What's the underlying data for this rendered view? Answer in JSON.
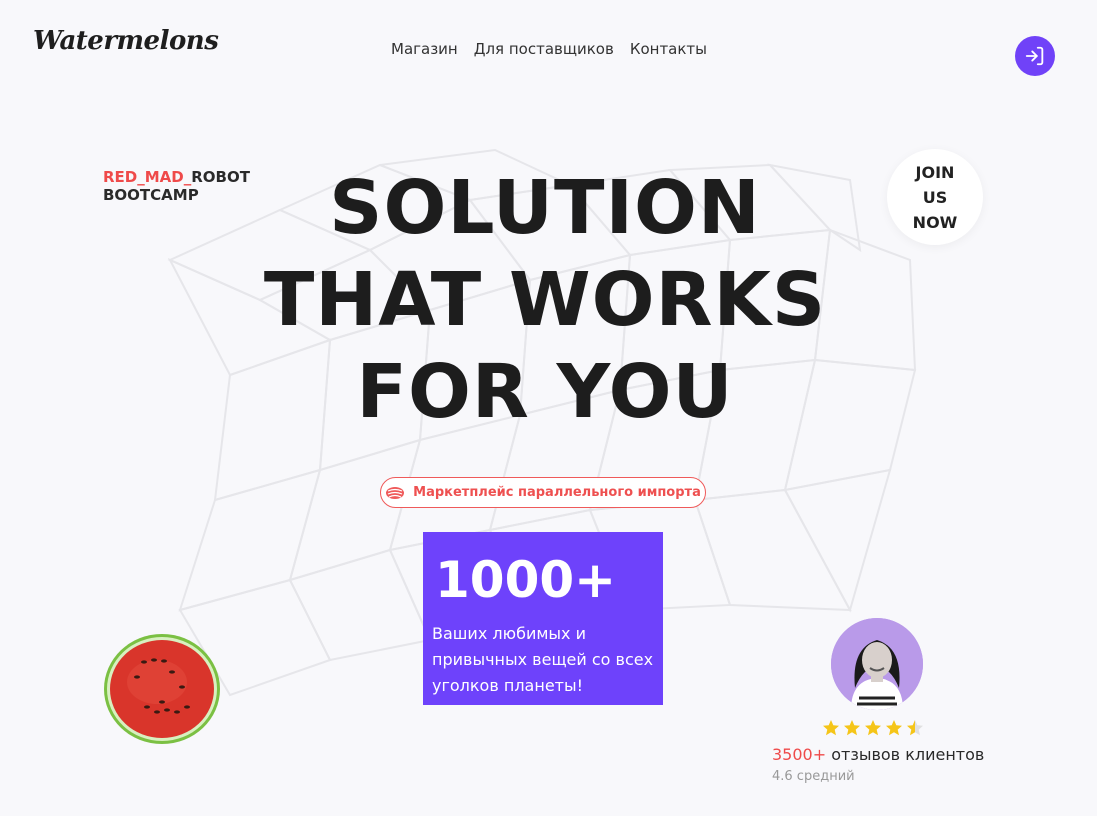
{
  "logo": {
    "text": "Watermelons"
  },
  "nav": {
    "items": [
      {
        "label": "Магазин"
      },
      {
        "label": "Для поставщиков"
      },
      {
        "label": "Контакты"
      }
    ]
  },
  "login": {
    "icon": "login-icon"
  },
  "brand_tag": {
    "red_part": "RED_MAD_",
    "dark_part": "ROBOT",
    "line2": "BOOTCAMP"
  },
  "join": {
    "line1": "JOIN",
    "line2": "US",
    "line3": "NOW"
  },
  "hero": {
    "line1": "SOLUTION",
    "line2": "THAT WORKS",
    "line3": "FOR YOU"
  },
  "pill": {
    "label": "Маркетплейс параллельного импорта",
    "icon": "watermelon-slice-icon"
  },
  "stat": {
    "number": "1000+",
    "text": "Ваших любимых и привычных вещей со всех уголков планеты!"
  },
  "reviews": {
    "count": "3500+",
    "label": " отзывов клиентов",
    "average": "4.6 средний",
    "stars": 4.5
  },
  "colors": {
    "accent": "#6e42fb",
    "brand_red": "#ef4a4a",
    "background": "#f8f8fb",
    "star": "#f5c518"
  }
}
